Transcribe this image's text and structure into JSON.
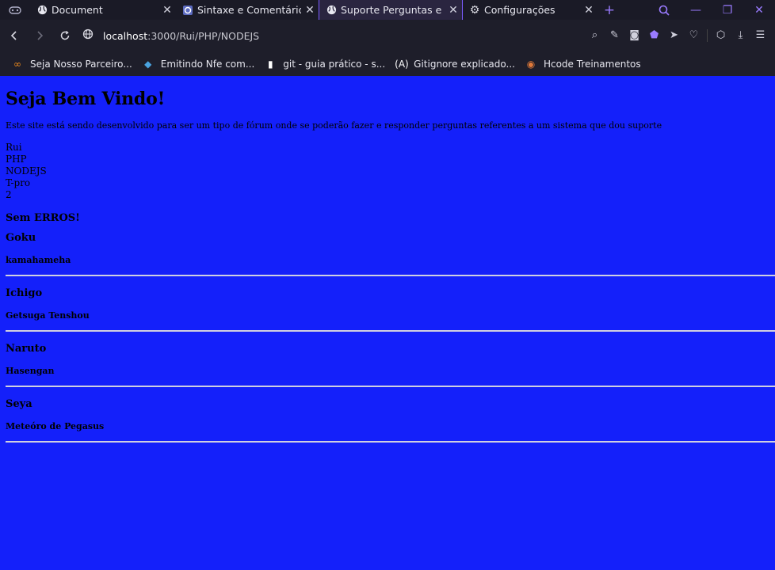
{
  "browser": {
    "tabs": [
      {
        "label": "Document",
        "icon": "globe-icon",
        "active": false
      },
      {
        "label": "Sintaxe e Comentários P",
        "icon": "page-icon",
        "active": false
      },
      {
        "label": "Suporte Perguntas e Res",
        "icon": "globe-icon",
        "active": true
      },
      {
        "label": "Configurações",
        "icon": "gear-icon",
        "active": false
      }
    ],
    "url_host": "localhost",
    "url_rest": ":3000/Rui/PHP/NODEJS",
    "bookmarks": [
      {
        "label": "Seja Nosso Parceiro...",
        "icon": "partner-icon"
      },
      {
        "label": "Emitindo Nfe com...",
        "icon": "cube-icon"
      },
      {
        "label": "git - guia prático - s...",
        "icon": "file-icon"
      },
      {
        "label": "Gitignore explicado...",
        "icon": "angular-icon"
      },
      {
        "label": "Hcode Treinamentos",
        "icon": "hcode-icon"
      }
    ],
    "accent": "#9a7bff"
  },
  "page": {
    "background": "#1420fa",
    "title": "Seja Bem Vindo!",
    "intro": "Este site está sendo desenvolvido para ser um tipo de fórum onde se poderão fazer e responder perguntas referentes a um sistema que dou suporte",
    "meta": [
      "Rui",
      "PHP",
      "NODEJS",
      "T-pro",
      "2"
    ],
    "status": "Sem ERROS!",
    "entries": [
      {
        "question": "Goku",
        "answer": "kamahameha"
      },
      {
        "question": "Ichigo",
        "answer": "Getsuga Tenshou"
      },
      {
        "question": "Naruto",
        "answer": "Hasengan"
      },
      {
        "question": "Seya",
        "answer": "Meteóro de Pegasus"
      }
    ]
  }
}
